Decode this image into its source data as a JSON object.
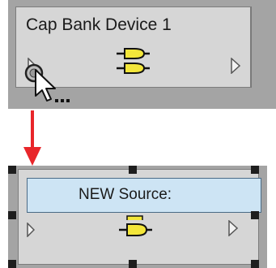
{
  "canvas": {
    "background_color": "#a4a4a4",
    "node_fill": "#d6d6d6"
  },
  "top_device": {
    "title": "Cap Bank Device 1",
    "icon": "capacitor-bank-icon",
    "left_port_icon": "port-triangle-icon",
    "right_port_icon": "port-triangle-icon",
    "cursor": "pointer-cursor-icon"
  },
  "transition": {
    "arrow_icon": "down-arrow-icon",
    "arrow_color": "#e8262a"
  },
  "bottom_device": {
    "edit_text": "NEW Source:",
    "edit_fill": "#cde4f4",
    "icon": "capacitor-bank-icon",
    "left_port_icon": "port-triangle-icon",
    "right_port_icon": "port-triangle-icon",
    "selection_handle_icon": "resize-handle-icon"
  }
}
